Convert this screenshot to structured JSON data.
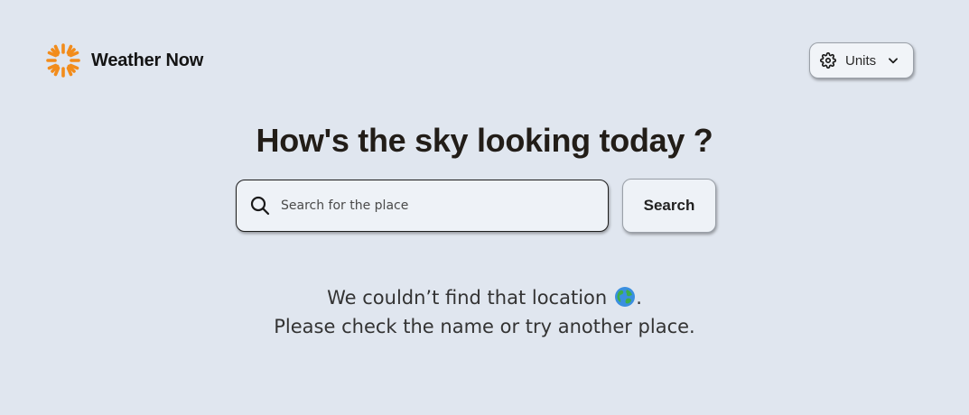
{
  "brand": {
    "name": "Weather Now",
    "logo_icon": "sun-icon",
    "accent_color": "#f28c1b"
  },
  "units": {
    "label": "Units",
    "icon": "gear-icon",
    "dropdown_icon": "chevron-down-icon"
  },
  "hero": {
    "headline": "How's the sky looking today ?"
  },
  "search": {
    "placeholder": "Search for the place",
    "value": "",
    "button_label": "Search",
    "icon": "search-icon"
  },
  "error": {
    "line1": "We couldn’t find that location",
    "line1_suffix": ".",
    "line2": "Please check the name or try another place.",
    "icon": "globe-icon"
  }
}
